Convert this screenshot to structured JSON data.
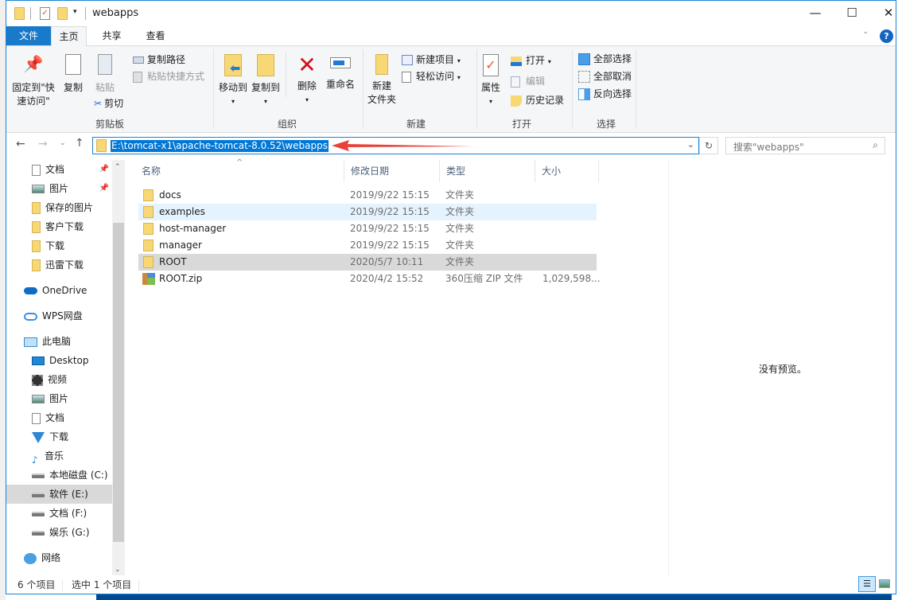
{
  "window": {
    "title": "webapps",
    "minimize": "—",
    "maximize": "☐",
    "close": "✕"
  },
  "tabs": [
    {
      "label": "文件"
    },
    {
      "label": "主页"
    },
    {
      "label": "共享"
    },
    {
      "label": "查看"
    }
  ],
  "ribbon": {
    "clipboard": {
      "label": "剪贴板",
      "pin": "固定到\"快速访问\"",
      "pin1": "固定到\"快",
      "pin2": "速访问\"",
      "copy": "复制",
      "paste": "粘贴",
      "copy_path": "复制路径",
      "paste_shortcut": "粘贴快捷方式",
      "cut": "剪切"
    },
    "organize": {
      "label": "组织",
      "move_to": "移动到",
      "copy_to": "复制到",
      "delete": "删除",
      "rename": "重命名"
    },
    "new": {
      "label": "新建",
      "new_folder1": "新建",
      "new_folder2": "文件夹",
      "new_item": "新建项目",
      "easy_access": "轻松访问"
    },
    "open": {
      "label": "打开",
      "properties": "属性",
      "open": "打开",
      "edit": "编辑",
      "history": "历史记录"
    },
    "select": {
      "label": "选择",
      "select_all": "全部选择",
      "select_none": "全部取消",
      "invert": "反向选择"
    }
  },
  "address": {
    "path": "E:\\tomcat-x1\\apache-tomcat-8.0.52\\webapps",
    "search_placeholder": "搜索\"webapps\""
  },
  "nav": [
    {
      "label": "文档",
      "icon": "document-icon",
      "pinned": true
    },
    {
      "label": "图片",
      "icon": "picture-icon",
      "pinned": true
    },
    {
      "label": "保存的图片",
      "icon": "folder-icon"
    },
    {
      "label": "客户下载",
      "icon": "folder-icon"
    },
    {
      "label": "下载",
      "icon": "folder-icon"
    },
    {
      "label": "迅雷下载",
      "icon": "folder-icon"
    },
    {
      "label": "OneDrive",
      "icon": "onedrive-icon"
    },
    {
      "label": "WPS网盘",
      "icon": "cloud-icon"
    },
    {
      "label": "此电脑",
      "icon": "computer-icon"
    },
    {
      "label": "Desktop",
      "icon": "desktop-icon"
    },
    {
      "label": "视频",
      "icon": "video-icon"
    },
    {
      "label": "图片",
      "icon": "picture-icon"
    },
    {
      "label": "文档",
      "icon": "document-icon"
    },
    {
      "label": "下载",
      "icon": "download-icon"
    },
    {
      "label": "音乐",
      "icon": "music-icon"
    },
    {
      "label": "本地磁盘 (C:)",
      "icon": "drive-icon"
    },
    {
      "label": "软件 (E:)",
      "icon": "drive-icon",
      "selected": true
    },
    {
      "label": "文档 (F:)",
      "icon": "drive-icon"
    },
    {
      "label": "娱乐 (G:)",
      "icon": "drive-icon"
    },
    {
      "label": "网络",
      "icon": "network-icon"
    }
  ],
  "columns": {
    "name": "名称",
    "date": "修改日期",
    "type": "类型",
    "size": "大小"
  },
  "files": [
    {
      "name": "docs",
      "date": "2019/9/22 15:15",
      "type": "文件夹",
      "size": ""
    },
    {
      "name": "examples",
      "date": "2019/9/22 15:15",
      "type": "文件夹",
      "size": "",
      "state": "hover"
    },
    {
      "name": "host-manager",
      "date": "2019/9/22 15:15",
      "type": "文件夹",
      "size": ""
    },
    {
      "name": "manager",
      "date": "2019/9/22 15:15",
      "type": "文件夹",
      "size": ""
    },
    {
      "name": "ROOT",
      "date": "2020/5/7 10:11",
      "type": "文件夹",
      "size": "",
      "state": "selected"
    },
    {
      "name": "ROOT.zip",
      "date": "2020/4/2 15:52",
      "type": "360压缩 ZIP 文件",
      "size": "1,029,598..."
    }
  ],
  "preview": {
    "text": "没有预览。"
  },
  "status": {
    "count": "6 个项目",
    "selected": "选中 1 个项目"
  },
  "colors": {
    "accent": "#0078d7",
    "file_tab": "#1979ca",
    "annotation_arrow": "#e8423a"
  }
}
